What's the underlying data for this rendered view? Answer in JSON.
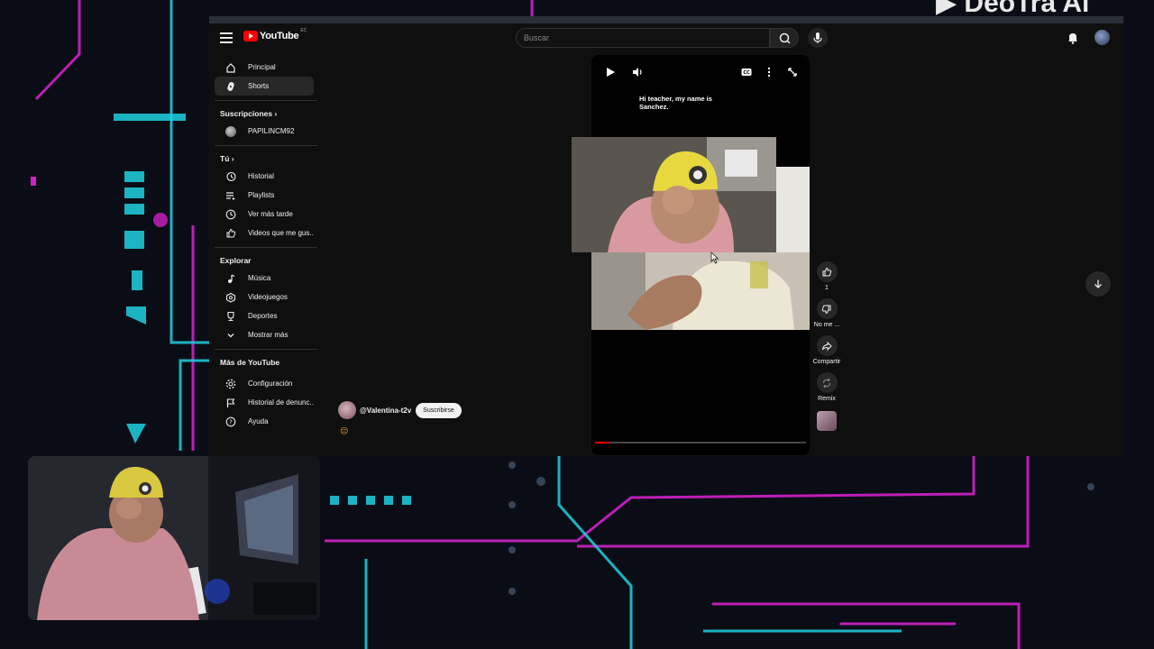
{
  "masthead": {
    "logo_text": "YouTube",
    "country_code": "EC",
    "search_placeholder": "Buscar"
  },
  "sidebar": {
    "main": [
      {
        "label": "Principal",
        "icon": "home-icon"
      },
      {
        "label": "Shorts",
        "icon": "shorts-icon",
        "active": true
      }
    ],
    "subscriptions_heading": "Suscripciones",
    "subscriptions": [
      {
        "label": "PAPILINCM92",
        "new_content": true
      }
    ],
    "you_heading": "Tú",
    "you": [
      {
        "label": "Historial",
        "icon": "history-icon"
      },
      {
        "label": "Playlists",
        "icon": "playlist-icon"
      },
      {
        "label": "Ver más tarde",
        "icon": "clock-icon"
      },
      {
        "label": "Videos que me gus...",
        "icon": "like-icon"
      }
    ],
    "explore_heading": "Explorar",
    "explore": [
      {
        "label": "Música",
        "icon": "music-icon"
      },
      {
        "label": "Videojuegos",
        "icon": "gamepad-icon"
      },
      {
        "label": "Deportes",
        "icon": "trophy-icon"
      },
      {
        "label": "Mostrar más",
        "icon": "chevron-down-icon"
      }
    ],
    "more_heading": "Más de YouTube",
    "more": [
      {
        "label": "Configuración",
        "icon": "gear-icon"
      },
      {
        "label": "Historial de denunc...",
        "icon": "flag-icon"
      },
      {
        "label": "Ayuda",
        "icon": "help-icon"
      }
    ]
  },
  "short": {
    "caption": "Hi teacher, my name is Sanchez.",
    "progress": 0.07,
    "channel_name": "@Valentina-t2v",
    "subscribe_label": "Suscribirse",
    "emoji": "😔"
  },
  "actions": {
    "like_count": "1",
    "dislike_label": "No me ...",
    "share_label": "Compartir",
    "remix_label": "Remix"
  },
  "colors": {
    "accent": "#ff0000",
    "neon_pink": "#e020d0",
    "neon_cyan": "#20d8e0"
  }
}
